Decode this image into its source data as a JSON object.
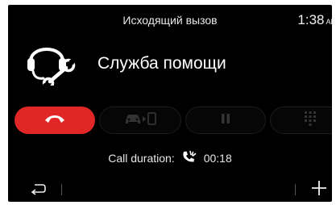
{
  "header": {
    "title": "Исходящий вызов",
    "time": "1:38",
    "ampm": "AM"
  },
  "contact": {
    "name": "Служба помощи",
    "icon": "headset-wrench-icon"
  },
  "controls": [
    {
      "name": "end-call",
      "icon": "phone-hangup-icon",
      "color": "#e12626",
      "enabled": true
    },
    {
      "name": "transfer-to-phone",
      "icon": "car-to-phone-icon",
      "enabled": false
    },
    {
      "name": "hold",
      "icon": "pause-icon",
      "enabled": false
    },
    {
      "name": "keypad",
      "icon": "keypad-icon",
      "enabled": false
    }
  ],
  "call": {
    "duration_label": "Call duration:",
    "duration_value": "00:18",
    "icon": "phone-ringing-icon"
  },
  "footer": {
    "back_icon": "back-arrow-icon",
    "add_icon": "plus-icon"
  },
  "colors": {
    "background": "#000000",
    "hangup": "#e12626",
    "disabled": "#2a2a2a"
  }
}
